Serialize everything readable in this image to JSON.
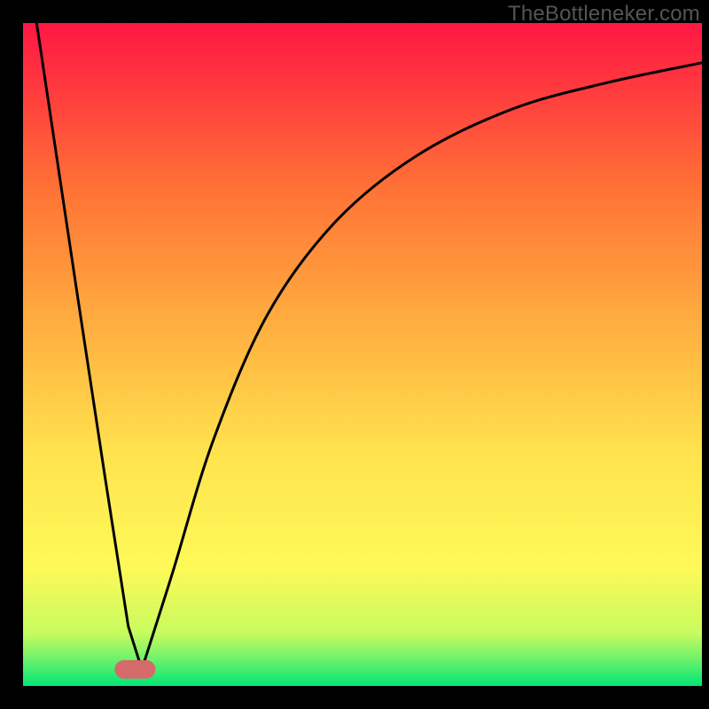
{
  "watermark": "TheBottleneker.com",
  "chart_data": {
    "type": "line",
    "title": "",
    "xlabel": "",
    "ylabel": "",
    "xlim": [
      0,
      100
    ],
    "ylim": [
      0,
      100
    ],
    "background_gradient": {
      "stops": [
        {
          "pos": 0.0,
          "color": "#00e676"
        },
        {
          "pos": 0.04,
          "color": "#6cf26b"
        },
        {
          "pos": 0.08,
          "color": "#c8fb5e"
        },
        {
          "pos": 0.18,
          "color": "#fef958"
        },
        {
          "pos": 0.35,
          "color": "#ffe34e"
        },
        {
          "pos": 0.55,
          "color": "#ffad3f"
        },
        {
          "pos": 0.75,
          "color": "#ff7236"
        },
        {
          "pos": 0.9,
          "color": "#ff3a3e"
        },
        {
          "pos": 1.0,
          "color": "#ff1744"
        }
      ]
    },
    "optimum_marker": {
      "x": 16.5,
      "y": 2.5,
      "width": 6,
      "height": 2.8
    },
    "series": [
      {
        "name": "left-branch",
        "style": "line",
        "x": [
          2,
          8,
          12,
          15.5,
          17.5
        ],
        "y": [
          100,
          59,
          32,
          9,
          2.5
        ]
      },
      {
        "name": "right-branch",
        "style": "curve",
        "x": [
          17.5,
          22,
          28,
          36,
          46,
          58,
          72,
          86,
          100
        ],
        "y": [
          2.5,
          17,
          37,
          56,
          70,
          80,
          87,
          91,
          94
        ]
      }
    ],
    "annotations": []
  }
}
